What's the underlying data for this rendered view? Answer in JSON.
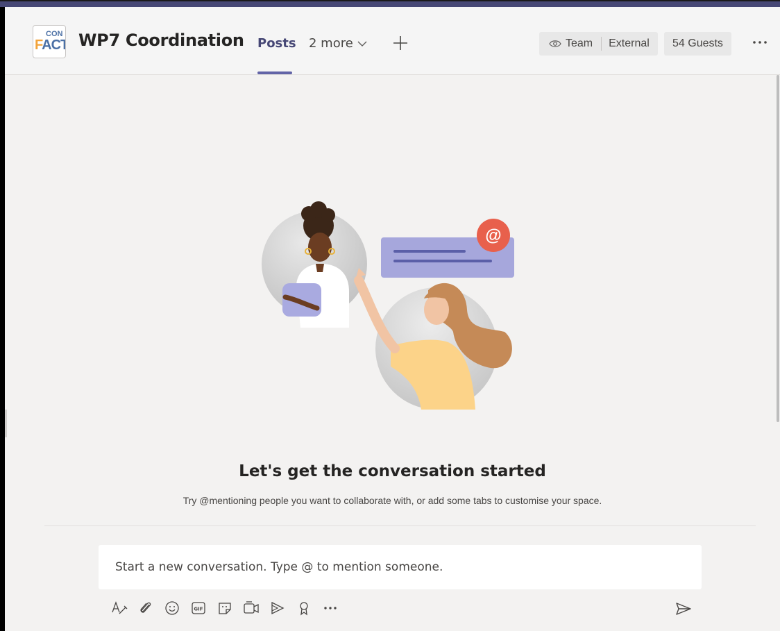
{
  "team": {
    "logo_text_top": "CON",
    "logo_text_bottom_a": "F",
    "logo_text_bottom_b": "ACT",
    "channel_title": "WP7 Coordination"
  },
  "tabs": [
    {
      "label": "Posts",
      "active": true
    },
    {
      "label": "2 more",
      "active": false
    }
  ],
  "header": {
    "team_label": "Team",
    "external_label": "External",
    "guests_label": "54 Guests",
    "icons": {
      "add_tab": "plus-icon",
      "team": "eye-icon",
      "more": "more-horizontal-icon",
      "more_tabs": "chevron-down-icon"
    }
  },
  "empty_state": {
    "title": "Let's get the conversation started",
    "subtitle": "Try @mentioning people you want to collaborate with, or add some tabs to customise your space.",
    "mention_symbol": "@"
  },
  "compose": {
    "placeholder": "Start a new conversation. Type @ to mention someone.",
    "value": ""
  },
  "toolbar": {
    "gif_label": "GIF",
    "icons": [
      "format-icon",
      "attach-icon",
      "emoji-icon",
      "gif-icon",
      "sticker-icon",
      "meet-icon",
      "stream-icon",
      "praise-icon",
      "more-horizontal-icon",
      "send-icon"
    ]
  },
  "colors": {
    "accent": "#6264a7",
    "accent_dark": "#464775",
    "background": "#f3f2f1",
    "mention_badge": "#e8604c",
    "message_card": "#a6a7dc"
  }
}
